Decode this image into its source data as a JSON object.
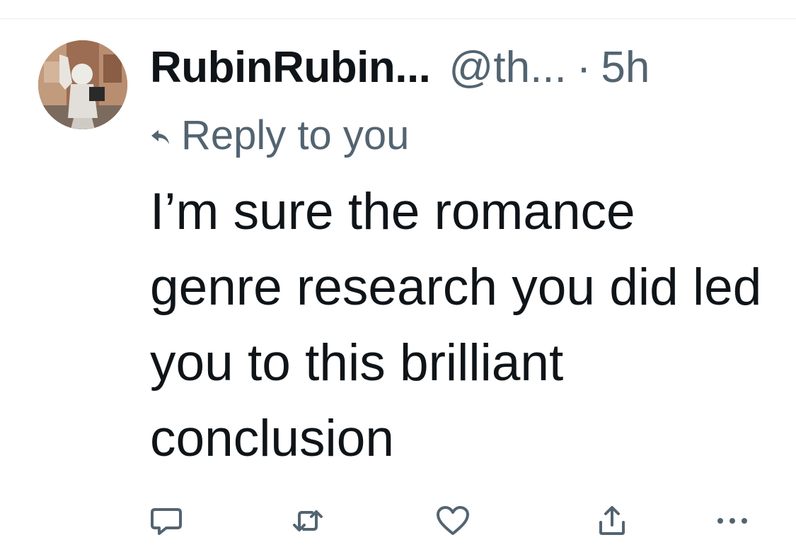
{
  "tweet": {
    "display_name": "RubinRubin...",
    "handle": "@th...",
    "separator": "·",
    "time": "5h",
    "reply_context": "Reply to you",
    "text": "I’m sure the romance genre research you did led you to this brilliant conclusion",
    "avatar_icon": "avatar-statue-photo"
  },
  "actions": {
    "items": [
      {
        "name": "reply",
        "icon": "comment-icon"
      },
      {
        "name": "retweet",
        "icon": "retweet-icon"
      },
      {
        "name": "like",
        "icon": "heart-icon"
      },
      {
        "name": "share",
        "icon": "share-icon"
      },
      {
        "name": "more",
        "icon": "more-icon"
      }
    ]
  },
  "colors": {
    "text_primary": "#0f1419",
    "text_secondary": "#536471",
    "divider": "#e6ecf0"
  }
}
